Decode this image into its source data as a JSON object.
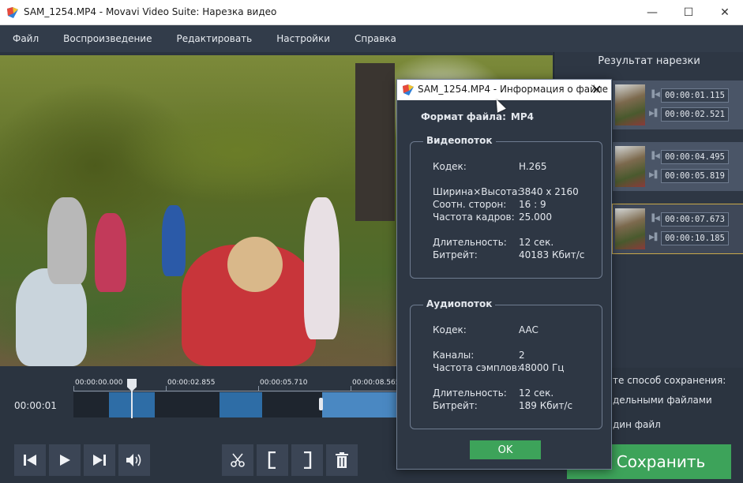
{
  "window": {
    "title": "SAM_1254.MP4 - Movavi Video Suite: Нарезка видео",
    "minimize": "—",
    "maximize": "☐",
    "close": "✕"
  },
  "menu": [
    "Файл",
    "Воспроизведение",
    "Редактировать",
    "Настройки",
    "Справка"
  ],
  "results": {
    "title": "Результат нарезки",
    "clips": [
      {
        "start": "00:00:01.115",
        "end": "00:00:02.521"
      },
      {
        "start": "00:00:04.495",
        "end": "00:00:05.819"
      },
      {
        "start": "00:00:07.673",
        "end": "00:00:10.185"
      }
    ]
  },
  "save": {
    "label": "те способ сохранения:",
    "option_separate": "дельными файлами",
    "option_single": "дин файл",
    "button": "Сохранить"
  },
  "timeline": {
    "current_time": "00:00:01",
    "ruler_labels": [
      "00:00:00.000",
      "00:00:02.855",
      "00:00:05.710",
      "00:00:08.565"
    ]
  },
  "dialog": {
    "title": "SAM_1254.MP4 - Информация о файле",
    "close": "✕",
    "format_label": "Формат файла:",
    "format_value": "MP4",
    "video": {
      "legend": "Видеопоток",
      "codec_label": "Кодек:",
      "codec": "H.265",
      "size_label": "Ширина×Высота:",
      "size": "3840 x 2160",
      "aspect_label": "Соотн. сторон:",
      "aspect": "16 : 9",
      "fps_label": "Частота кадров:",
      "fps": "25.000",
      "duration_label": "Длительность:",
      "duration": "12 сек.",
      "bitrate_label": "Битрейт:",
      "bitrate": "40183 Кбит/с"
    },
    "audio": {
      "legend": "Аудиопоток",
      "codec_label": "Кодек:",
      "codec": "AAC",
      "channels_label": "Каналы:",
      "channels": "2",
      "samplerate_label": "Частота сэмплов:",
      "samplerate": "48000 Гц",
      "duration_label": "Длительность:",
      "duration": "12 сек.",
      "bitrate_label": "Битрейт:",
      "bitrate": "189 Кбит/с"
    },
    "ok": "OK"
  }
}
